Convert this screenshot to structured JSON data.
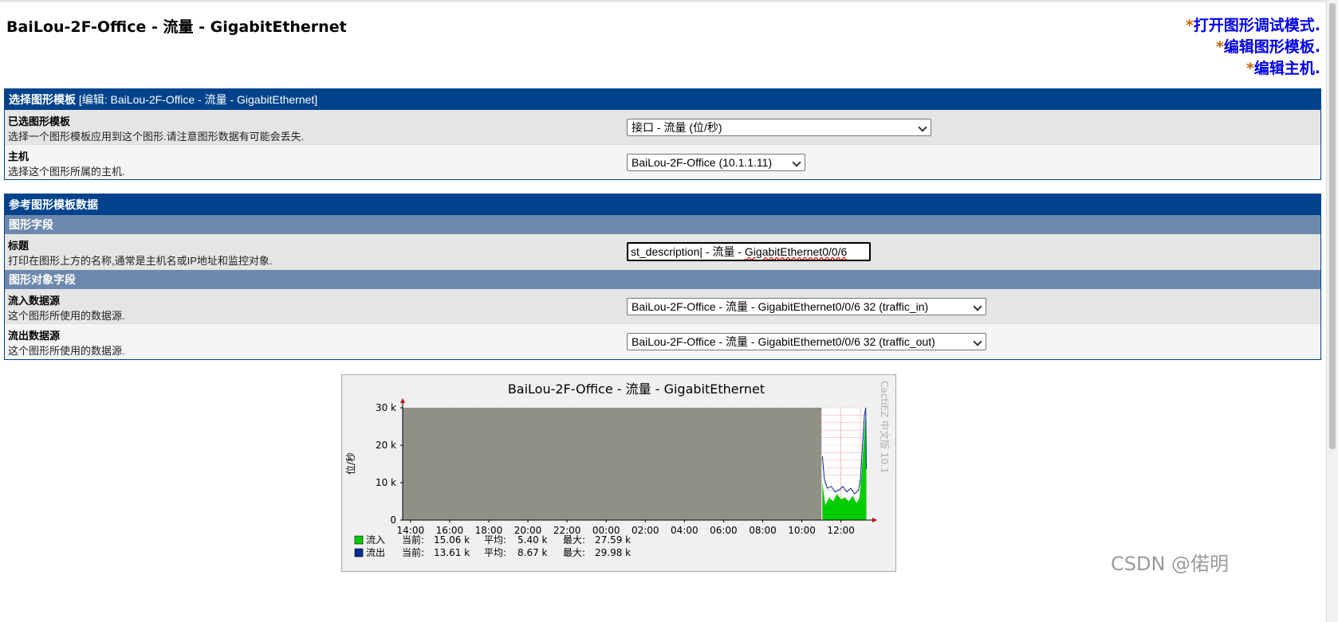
{
  "page": {
    "title": "BaiLou-2F-Office - 流量 - GigabitEthernet",
    "actions": [
      {
        "star": "*",
        "label": "打开图形调试模式."
      },
      {
        "star": "*",
        "label": "编辑图形模板."
      },
      {
        "star": "*",
        "label": "编辑主机."
      }
    ]
  },
  "template_box": {
    "header_title": "选择图形模板",
    "header_edit": "[编辑: BaiLou-2F-Office - 流量 - GigabitEthernet]",
    "rows": [
      {
        "label": "已选图形模板",
        "desc": "选择一个图形模板应用到这个图形.请注意图形数据有可能会丢失.",
        "value": "接口 - 流量 (位/秒)"
      },
      {
        "label": "主机",
        "desc": "选择这个图形所属的主机.",
        "value": "BaiLou-2F-Office (10.1.1.11)"
      }
    ]
  },
  "data_box": {
    "header_title": "参考图形模板数据",
    "graph_fields_title": "图形字段",
    "title_row": {
      "label": "标题",
      "desc": "打印在图形上方的名称,通常是主机名或IP地址和监控对象.",
      "value_prefix": "st_description| - 流量 - ",
      "value_spell": "GigabitEthernet0/0/6"
    },
    "graph_items_title": "图形对象字段",
    "rows": [
      {
        "label": "流入数据源",
        "desc": "这个图形所使用的数据源.",
        "value": "BaiLou-2F-Office - 流量 - GigabitEthernet0/0/6 32 (traffic_in)"
      },
      {
        "label": "流出数据源",
        "desc": "这个图形所使用的数据源.",
        "value": "BaiLou-2F-Office - 流量 - GigabitEthernet0/0/6 32 (traffic_out)"
      }
    ]
  },
  "chart_data": {
    "type": "area",
    "title": "BaiLou-2F-Office - 流量 - GigabitEthernet",
    "ylabel": "位/秒",
    "side_label": "CactiEZ 中文版 10.1",
    "y_ticks": [
      "0",
      "10 k",
      "20 k",
      "30 k"
    ],
    "ylim": [
      0,
      30000
    ],
    "x_ticks": [
      "14:00",
      "16:00",
      "18:00",
      "20:00",
      "22:00",
      "00:00",
      "02:00",
      "04:00",
      "06:00",
      "08:00",
      "10:00",
      "12:00"
    ],
    "xlim_hours": [
      13.6,
      37.4
    ],
    "no_data_until_hour": 35.0,
    "series": [
      {
        "name": "流入",
        "color": "#00cc00",
        "stats": {
          "current_label": "当前:",
          "current": "15.06 k",
          "avg_label": "平均:",
          "avg": "5.40 k",
          "max_label": "最大:",
          "max": "27.59 k"
        },
        "points": [
          [
            35.05,
            10000
          ],
          [
            35.2,
            4000
          ],
          [
            35.4,
            6000
          ],
          [
            35.6,
            5000
          ],
          [
            35.8,
            7000
          ],
          [
            36.0,
            5500
          ],
          [
            36.2,
            6000
          ],
          [
            36.4,
            5000
          ],
          [
            36.6,
            6500
          ],
          [
            36.8,
            4500
          ],
          [
            36.95,
            6000
          ],
          [
            37.05,
            12000
          ],
          [
            37.15,
            20000
          ],
          [
            37.25,
            27590
          ],
          [
            37.3,
            15060
          ]
        ]
      },
      {
        "name": "流出",
        "color": "#002a97",
        "stats": {
          "current_label": "当前:",
          "current": "13.61 k",
          "avg_label": "平均:",
          "avg": "8.67 k",
          "max_label": "最大:",
          "max": "29.98 k"
        },
        "points": [
          [
            35.05,
            17000
          ],
          [
            35.15,
            11000
          ],
          [
            35.3,
            8500
          ],
          [
            35.5,
            9000
          ],
          [
            35.7,
            7500
          ],
          [
            35.9,
            8000
          ],
          [
            36.1,
            9000
          ],
          [
            36.3,
            7500
          ],
          [
            36.5,
            8500
          ],
          [
            36.7,
            7000
          ],
          [
            36.9,
            8000
          ],
          [
            37.0,
            11000
          ],
          [
            37.1,
            20000
          ],
          [
            37.2,
            28000
          ],
          [
            37.27,
            29980
          ],
          [
            37.3,
            13610
          ]
        ]
      }
    ]
  },
  "watermark": "CSDN @偌明"
}
